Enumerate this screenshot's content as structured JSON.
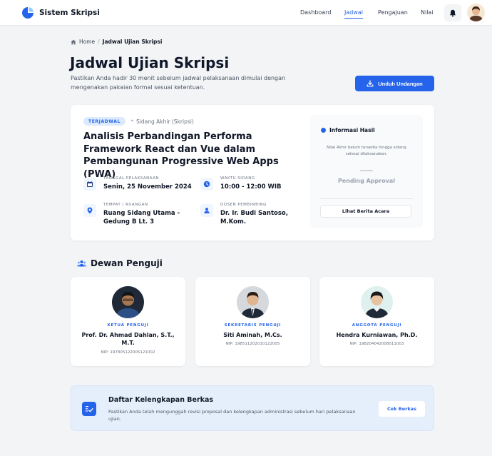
{
  "app": {
    "name": "Sistem Skripsi"
  },
  "nav": {
    "items": [
      "Dashboard",
      "Jadwal",
      "Pengajuan",
      "Nilai"
    ],
    "active": "Jadwal"
  },
  "breadcrumb": {
    "home": "Home",
    "separator": "/",
    "current": "Jadwal Ujian Skripsi"
  },
  "page": {
    "title": "Jadwal Ujian Skripsi",
    "subtitle": "Pastikan Anda hadir 30 menit sebelum jadwal pelaksanaan dimulai dengan mengenakan pakaian formal sesuai ketentuan.",
    "download_label": "Unduh Undangan"
  },
  "exam": {
    "status_badge": "TERJADWAL",
    "stage": "Sidang Akhir (Skripsi)",
    "title": "Analisis Perbandingan Performa Framework React dan Vue dalam Pembangunan Progressive Web Apps (PWA)",
    "date_label": "TANGGAL PELAKSANAAN",
    "date_value": "Senin, 25 November 2024",
    "time_label": "WAKTU SIDANG",
    "time_value": "10:00 - 12:00 WIB",
    "place_label": "TEMPAT / RUANGAN",
    "place_value": "Ruang Sidang Utama - Gedung B Lt. 3",
    "advisor_label": "DOSEN PEMBIMBING",
    "advisor_value": "Dr. Ir. Budi Santoso, M.Kom."
  },
  "result": {
    "title": "Informasi Hasil",
    "note": "Nilai Akhir belum tersedia hingga sidang selesai dilaksanakan.",
    "status": "Pending Approval",
    "button_label": "Lihat Berita Acara"
  },
  "committee": {
    "title": "Dewan Penguji",
    "members": [
      {
        "role": "KETUA PENGUJI",
        "name": "Prof. Dr. Ahmad Dahlan, S.T., M.T.",
        "nip": "NIP: 197805122005121002"
      },
      {
        "role": "SEKRETARIS PENGUJI",
        "name": "Siti Aminah, M.Cs.",
        "nip": "NIP: 198511202010122005"
      },
      {
        "role": "ANGGOTA PENGUJI",
        "name": "Hendra Kurniawan, Ph.D.",
        "nip": "NIP: 198204042008011003"
      }
    ]
  },
  "documents": {
    "title": "Daftar Kelengkapan Berkas",
    "description": "Pastikan Anda telah mengunggah revisi proposal dan kelengkapan administrasi sebelum hari pelaksanaan ujian.",
    "button_label": "Cek Berkas"
  },
  "icons": {
    "brand": "logo-icon",
    "bell": "bell-icon",
    "home": "home-icon",
    "download": "download-icon",
    "calendar": "calendar-icon",
    "clock": "clock-icon",
    "location": "location-pin-icon",
    "person": "person-icon",
    "group": "group-icon",
    "checklist": "checklist-icon"
  },
  "colors": {
    "accent": "#2563eb",
    "background": "#f3f4f6",
    "card": "#ffffff",
    "badge_bg": "#dbeafe",
    "docs_bg": "#e5effc"
  }
}
